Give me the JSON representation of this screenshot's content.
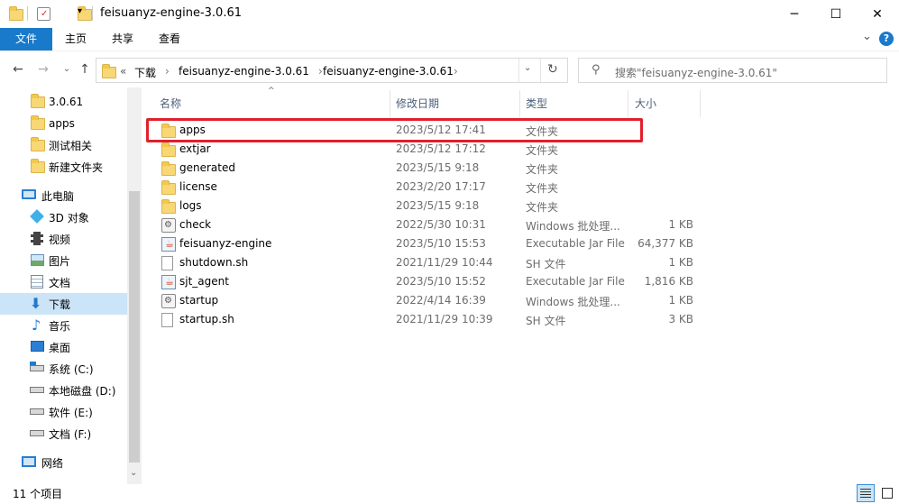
{
  "window": {
    "title": "feisuanyz-engine-3.0.61",
    "minimize": "─",
    "maximize": "☐",
    "close": "✕"
  },
  "ribbon": {
    "tabs": [
      "文件",
      "主页",
      "共享",
      "查看"
    ],
    "expand": "⌄",
    "help": "?"
  },
  "nav": {
    "breadcrumb_overflow": "«",
    "breadcrumb": [
      "下载",
      "feisuanyz-engine-3.0.61",
      "feisuanyz-engine-3.0.61"
    ],
    "search_placeholder": "搜索\"feisuanyz-engine-3.0.61\""
  },
  "sidebar": {
    "items": [
      {
        "label": "3.0.61",
        "icon": "folder-icon"
      },
      {
        "label": "apps",
        "icon": "folder-icon"
      },
      {
        "label": "测试相关",
        "icon": "folder-icon"
      },
      {
        "label": "新建文件夹",
        "icon": "folder-icon"
      },
      {
        "label": "此电脑",
        "icon": "computer-icon"
      },
      {
        "label": "3D 对象",
        "icon": "cube-icon"
      },
      {
        "label": "视频",
        "icon": "video-icon"
      },
      {
        "label": "图片",
        "icon": "picture-icon"
      },
      {
        "label": "文档",
        "icon": "document-icon"
      },
      {
        "label": "下载",
        "icon": "download-icon"
      },
      {
        "label": "音乐",
        "icon": "music-icon"
      },
      {
        "label": "桌面",
        "icon": "desktop-icon"
      },
      {
        "label": "系统 (C:)",
        "icon": "drive-icon"
      },
      {
        "label": "本地磁盘 (D:)",
        "icon": "drive-icon"
      },
      {
        "label": "软件 (E:)",
        "icon": "drive-icon"
      },
      {
        "label": "文档 (F:)",
        "icon": "drive-icon"
      },
      {
        "label": "网络",
        "icon": "network-icon"
      }
    ]
  },
  "columns": {
    "name": "名称",
    "date": "修改日期",
    "type": "类型",
    "size": "大小"
  },
  "files": [
    {
      "name": "apps",
      "date": "2023/5/12 17:41",
      "type": "文件夹",
      "size": "",
      "icon": "folder-icon"
    },
    {
      "name": "extjar",
      "date": "2023/5/12 17:12",
      "type": "文件夹",
      "size": "",
      "icon": "folder-icon"
    },
    {
      "name": "generated",
      "date": "2023/5/15 9:18",
      "type": "文件夹",
      "size": "",
      "icon": "folder-icon"
    },
    {
      "name": "license",
      "date": "2023/2/20 17:17",
      "type": "文件夹",
      "size": "",
      "icon": "folder-icon"
    },
    {
      "name": "logs",
      "date": "2023/5/15 9:18",
      "type": "文件夹",
      "size": "",
      "icon": "folder-icon"
    },
    {
      "name": "check",
      "date": "2022/5/30 10:31",
      "type": "Windows 批处理...",
      "size": "1 KB",
      "icon": "batch-file-icon"
    },
    {
      "name": "feisuanyz-engine",
      "date": "2023/5/10 15:53",
      "type": "Executable Jar File",
      "size": "64,377 KB",
      "icon": "jar-file-icon"
    },
    {
      "name": "shutdown.sh",
      "date": "2021/11/29 10:44",
      "type": "SH 文件",
      "size": "1 KB",
      "icon": "file-icon"
    },
    {
      "name": "sjt_agent",
      "date": "2023/5/10 15:52",
      "type": "Executable Jar File",
      "size": "1,816 KB",
      "icon": "jar-file-icon"
    },
    {
      "name": "startup",
      "date": "2022/4/14 16:39",
      "type": "Windows 批处理...",
      "size": "1 KB",
      "icon": "batch-file-icon"
    },
    {
      "name": "startup.sh",
      "date": "2021/11/29 10:39",
      "type": "SH 文件",
      "size": "3 KB",
      "icon": "file-icon"
    }
  ],
  "status": {
    "item_count": "11 个项目"
  },
  "colors": {
    "accent": "#1979ca",
    "selection": "#cce4f7",
    "highlight_box": "#e0202c",
    "folder": "#f8d775"
  }
}
